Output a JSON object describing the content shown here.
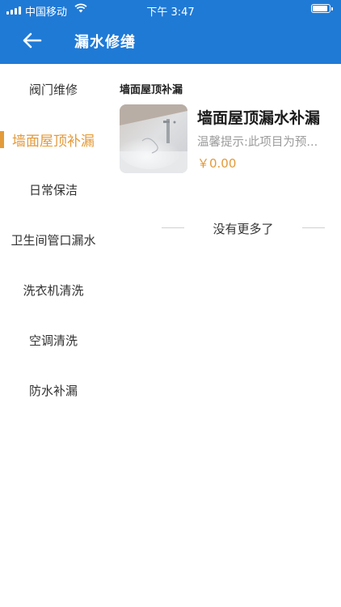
{
  "status_bar": {
    "carrier": "中国移动",
    "time": "下午 3:47"
  },
  "nav": {
    "title": "漏水修缮",
    "back_icon": "arrow-left-icon"
  },
  "sidebar": {
    "items": [
      {
        "label": "阀门维修",
        "active": false
      },
      {
        "label": "墙面屋顶补漏",
        "active": true
      },
      {
        "label": "日常保洁",
        "active": false
      },
      {
        "label": "卫生间管口漏水",
        "active": false
      },
      {
        "label": "洗衣机清洗",
        "active": false
      },
      {
        "label": "空调清洗",
        "active": false
      },
      {
        "label": "防水补漏",
        "active": false
      }
    ],
    "accent_color": "#e39a3a"
  },
  "content": {
    "section_title": "墙面屋顶补漏",
    "products": [
      {
        "name": "墙面屋顶漏水补漏",
        "description": "温馨提示:此项目为预...",
        "price": "￥0.00"
      }
    ],
    "end_text": "没有更多了"
  },
  "colors": {
    "header_bg": "#1f7ad6",
    "accent": "#e39a3a"
  }
}
